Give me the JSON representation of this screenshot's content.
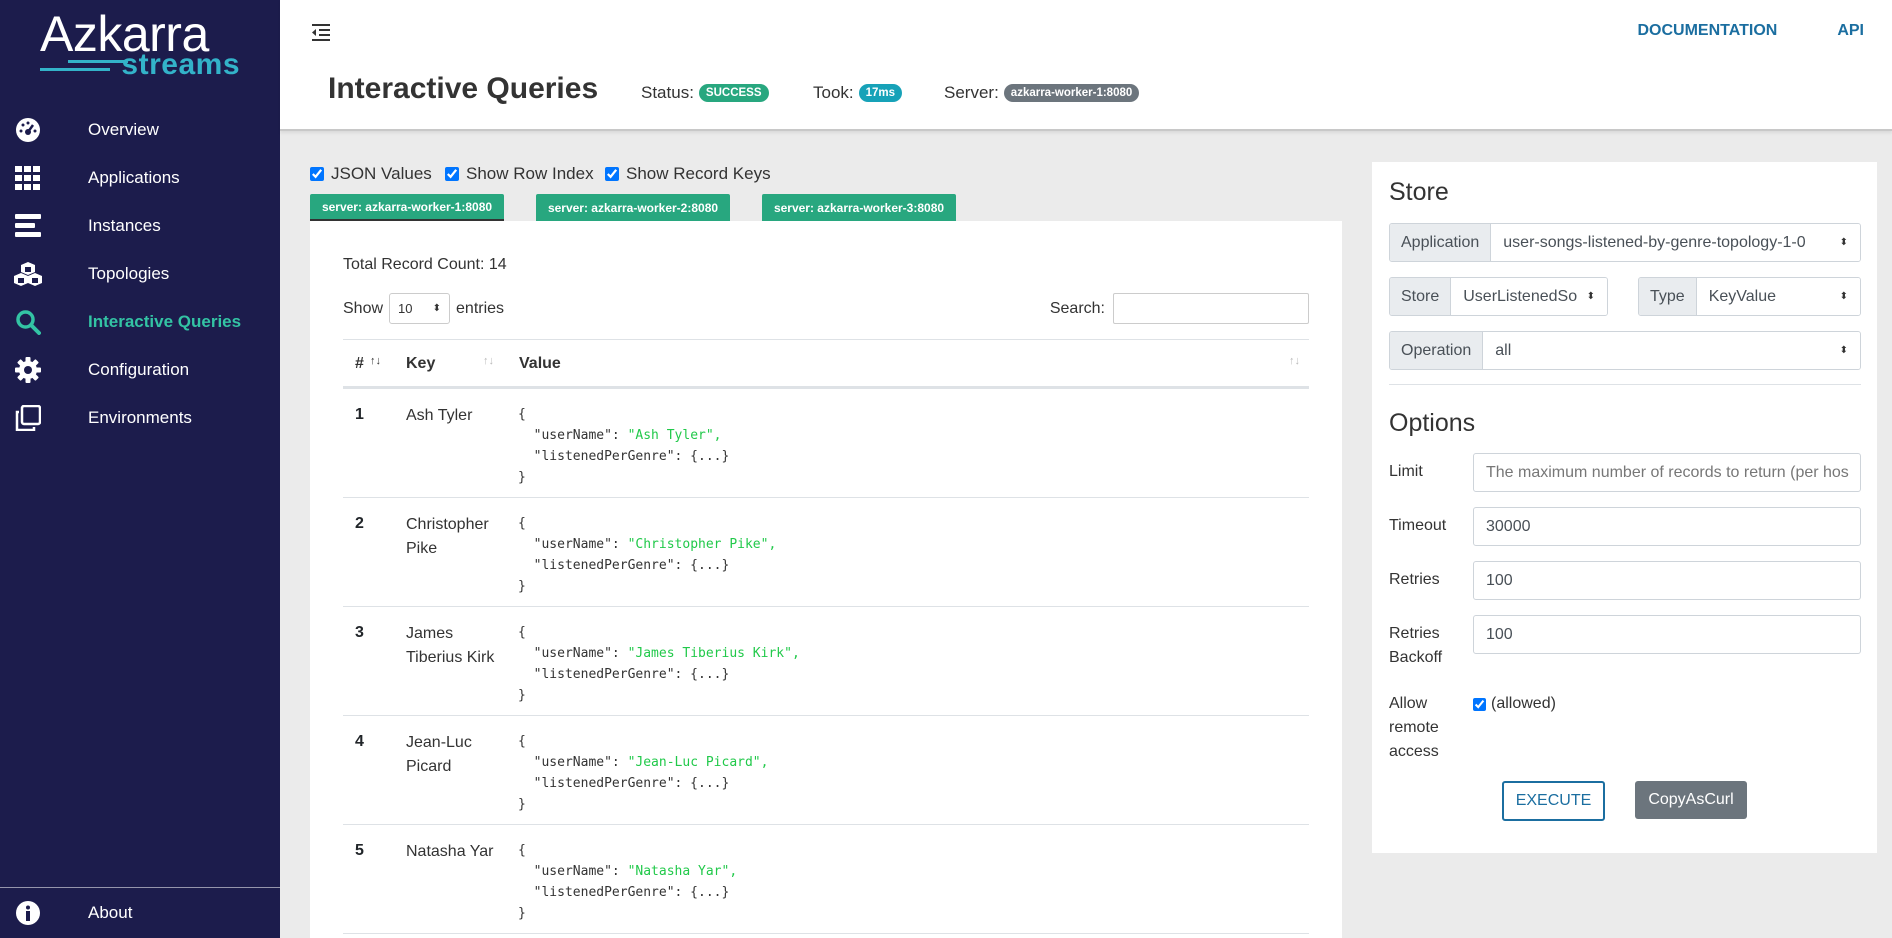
{
  "logo": {
    "word1": "Azkarra",
    "word2": "streams"
  },
  "sidebar": {
    "items": [
      {
        "label": "Overview",
        "icon": "dashboard-icon"
      },
      {
        "label": "Applications",
        "icon": "grid-icon"
      },
      {
        "label": "Instances",
        "icon": "server-icon"
      },
      {
        "label": "Topologies",
        "icon": "cubes-icon"
      },
      {
        "label": "Interactive Queries",
        "icon": "search-icon",
        "active": true
      },
      {
        "label": "Configuration",
        "icon": "gear-icon"
      },
      {
        "label": "Environments",
        "icon": "clone-icon"
      }
    ],
    "about": "About"
  },
  "header": {
    "links": [
      "DOCUMENTATION",
      "API"
    ],
    "title": "Interactive Queries",
    "status_label": "Status:",
    "status_value": "SUCCESS",
    "took_label": "Took:",
    "took_value": "17ms",
    "server_label": "Server:",
    "server_value": "azkarra-worker-1:8080"
  },
  "options_row": {
    "json_values": "JSON Values",
    "show_row_index": "Show Row Index",
    "show_record_keys": "Show Record Keys"
  },
  "server_tabs": [
    "server: azkarra-worker-1:8080",
    "server: azkarra-worker-2:8080",
    "server: azkarra-worker-3:8080"
  ],
  "table": {
    "record_count": "Total Record Count: 14",
    "show_label": "Show",
    "show_value": "10",
    "entries_label": "entries",
    "search_label": "Search:",
    "columns": [
      "#",
      "Key",
      "Value"
    ],
    "rows": [
      {
        "idx": "1",
        "key": "Ash Tyler",
        "userName": "\"Ash Tyler\","
      },
      {
        "idx": "2",
        "key": "Christopher Pike",
        "userName": "\"Christopher Pike\","
      },
      {
        "idx": "3",
        "key": "James Tiberius Kirk",
        "userName": "\"James Tiberius Kirk\","
      },
      {
        "idx": "4",
        "key": "Jean-Luc Picard",
        "userName": "\"Jean-Luc Picard\","
      },
      {
        "idx": "5",
        "key": "Natasha Yar",
        "userName": "\"Natasha Yar\","
      }
    ],
    "json_open": "{",
    "json_close": "}",
    "field_username": "  \"userName\": ",
    "field_listened": "  \"listenedPerGenre\": {...}"
  },
  "store": {
    "title": "Store",
    "application_label": "Application",
    "application_value": "user-songs-listened-by-genre-topology-1-0",
    "store_label": "Store",
    "store_value": "UserListenedSo",
    "type_label": "Type",
    "type_value": "KeyValue",
    "operation_label": "Operation",
    "operation_value": "all"
  },
  "options": {
    "title": "Options",
    "limit_label": "Limit",
    "limit_placeholder": "The maximum number of records to return (per hos",
    "timeout_label": "Timeout",
    "timeout_value": "30000",
    "retries_label": "Retries",
    "retries_value": "100",
    "retries_backoff_label": "Retries Backoff",
    "retries_backoff_value": "100",
    "allow_remote_label": "Allow remote access",
    "allow_remote_value": "(allowed)",
    "execute": "EXECUTE",
    "copy_curl": "CopyAsCurl"
  },
  "colors": {
    "sidebar": "#1c1c4c",
    "accent": "#33c3a4",
    "success": "#28a77f",
    "link": "#1b6ea0",
    "badge_took": "#17a2b8",
    "badge_server": "#6c757d"
  }
}
